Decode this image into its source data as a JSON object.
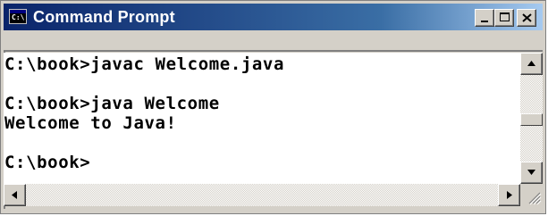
{
  "window": {
    "title": "Command Prompt",
    "icon_label": "C:\\",
    "icon_name": "command-prompt-icon"
  },
  "console": {
    "lines": [
      "C:\\book>javac Welcome.java",
      "",
      "C:\\book>java Welcome",
      "Welcome to Java!",
      "",
      "C:\\book>"
    ]
  },
  "controls": {
    "minimize_icon": "minimize-icon",
    "maximize_icon": "maximize-icon",
    "close_icon": "close-icon"
  },
  "scroll": {
    "vertical_position_fraction": 0.55
  },
  "colors": {
    "titlebar_start": "#0a246a",
    "titlebar_end": "#a6caf0",
    "chrome": "#d4d0c8",
    "console_bg": "#ffffff",
    "console_text": "#000000"
  }
}
